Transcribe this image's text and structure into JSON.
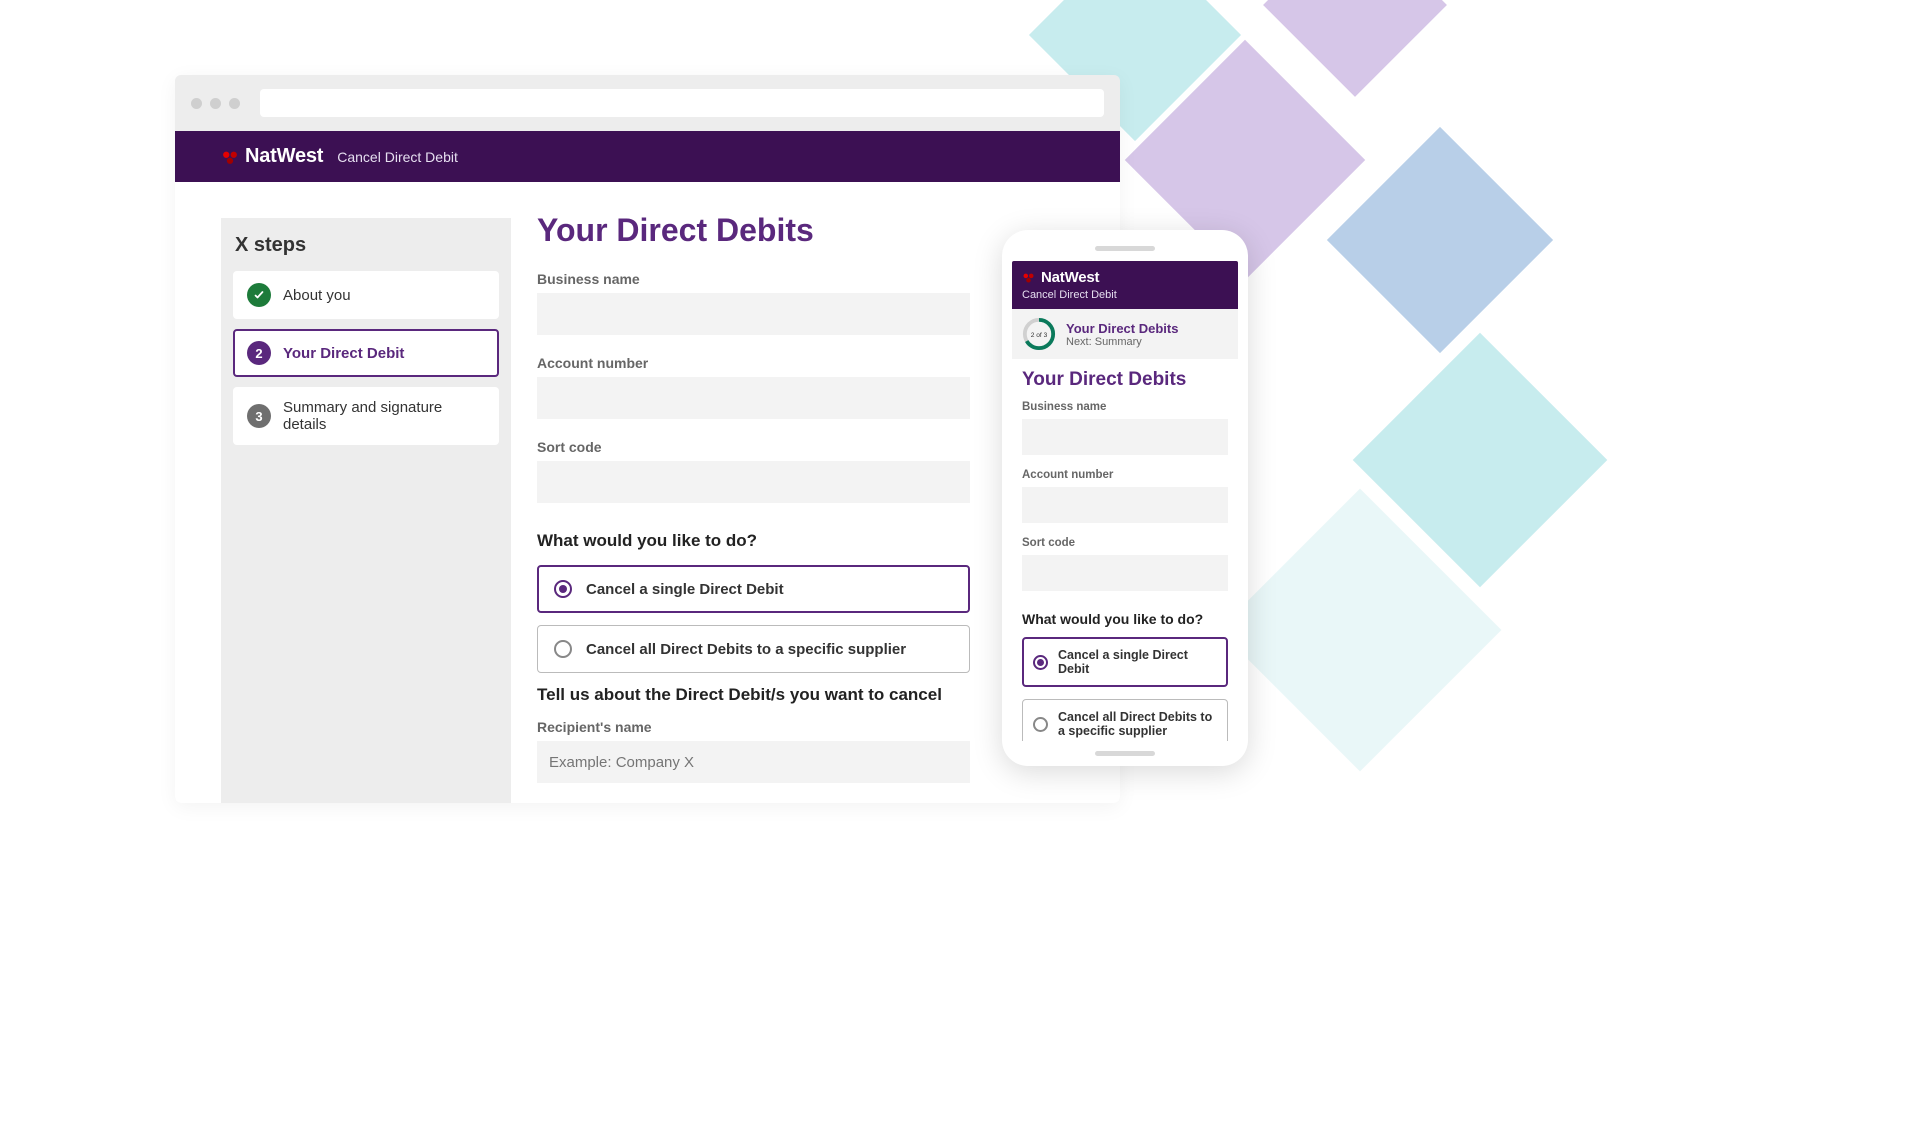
{
  "brand": {
    "name": "NatWest",
    "accent_color": "#3c1053",
    "logo_color": "#e60000"
  },
  "app_subtitle": "Cancel Direct Debit",
  "sidebar": {
    "title": "X steps",
    "steps": [
      {
        "num": "✓",
        "label": "About you",
        "state": "completed"
      },
      {
        "num": "2",
        "label": "Your Direct Debit",
        "state": "active"
      },
      {
        "num": "3",
        "label": "Summary and signature details",
        "state": "pending"
      }
    ]
  },
  "form": {
    "title": "Your Direct Debits",
    "fields": {
      "business_name": {
        "label": "Business name",
        "value": ""
      },
      "account_number": {
        "label": "Account number",
        "value": ""
      },
      "sort_code": {
        "label": "Sort code",
        "value": ""
      }
    },
    "action_heading": "What would you like to do?",
    "options": [
      {
        "label": "Cancel a single Direct Debit",
        "selected": true
      },
      {
        "label": "Cancel all Direct Debits to a specific supplier",
        "selected": false
      }
    ],
    "details_heading": "Tell us about the Direct Debit/s you want to cancel",
    "recipient_name": {
      "label": "Recipient's name",
      "placeholder": "Example: Company X",
      "value": ""
    }
  },
  "mobile": {
    "progress": {
      "counter": "2 of 3",
      "title": "Your Direct Debits",
      "next": "Next: Summary"
    }
  }
}
